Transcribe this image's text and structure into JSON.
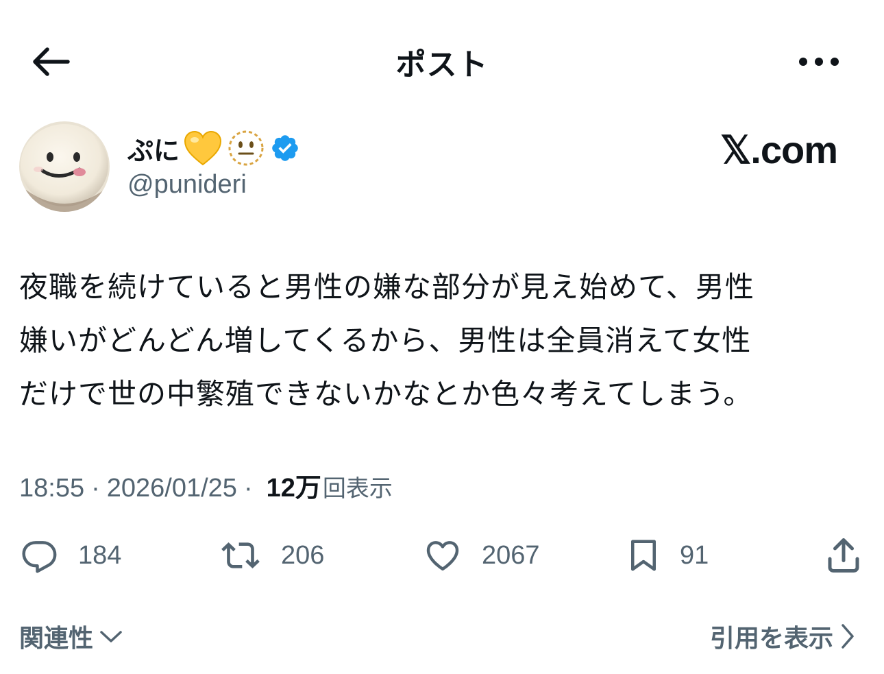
{
  "header": {
    "title": "ポスト",
    "back_icon": "arrow-left-icon",
    "more_icon": "more-horizontal-icon"
  },
  "author": {
    "display_name": "ぷに",
    "handle": "@punideri",
    "badges": [
      "yellow-heart-emoji",
      "dotted-line-face-emoji",
      "verified-badge-icon"
    ],
    "verified_color": "#1d9bf0"
  },
  "brand": {
    "watermark": "𝕏.com"
  },
  "tweet": {
    "lines": [
      "夜職を続けていると男性の嫌な部分が見え始めて、男性",
      "嫌いがどんどん増してくるから、男性は全員消えて女性",
      "だけで世の中繁殖できないかなとか色々考えてしまう。"
    ]
  },
  "meta": {
    "time": "18:55",
    "date": "2026/01/25",
    "views_count": "12万",
    "views_label": "回表示",
    "separator": "·"
  },
  "actions": {
    "replies": "184",
    "reposts": "206",
    "likes": "2067",
    "bookmarks": "91"
  },
  "footer": {
    "relevance_label": "関連性",
    "quotes_label": "引用を表示"
  },
  "colors": {
    "text": "#0f1419",
    "secondary": "#536471",
    "accent": "#1d9bf0",
    "heart": "#ffc83d"
  }
}
